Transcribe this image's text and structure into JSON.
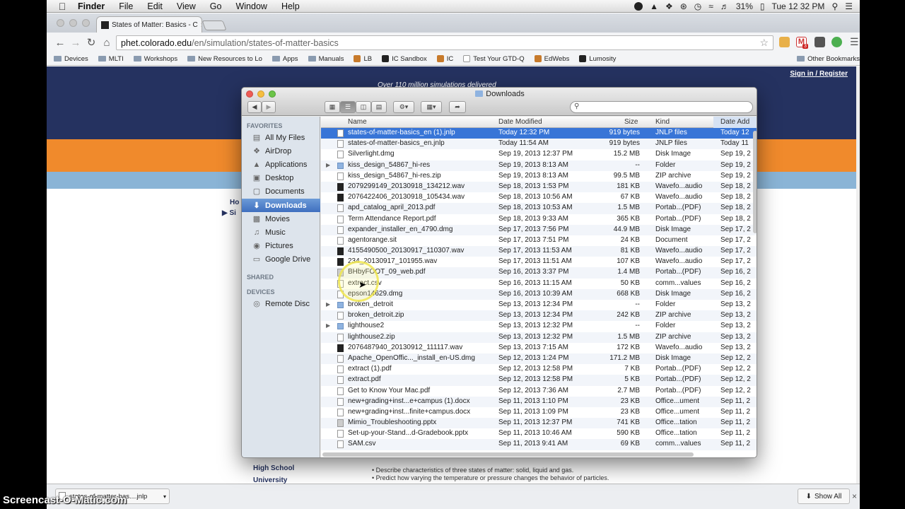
{
  "menubar": {
    "app": "Finder",
    "items": [
      "File",
      "Edit",
      "View",
      "Go",
      "Window",
      "Help"
    ],
    "battery": "31%",
    "clock": "Tue 12 32 PM"
  },
  "browser": {
    "tab_title": "States of Matter: Basics - C",
    "url_host": "phet.colorado.edu",
    "url_path": "/en/simulation/states-of-matter-basics",
    "bookmarks": [
      {
        "label": "Devices",
        "icon": "folder-icon"
      },
      {
        "label": "MLTI",
        "icon": "folder-icon"
      },
      {
        "label": "Workshops",
        "icon": "folder-icon"
      },
      {
        "label": "New Resources to Lo",
        "icon": "folder-icon"
      },
      {
        "label": "Apps",
        "icon": "folder-icon"
      },
      {
        "label": "Manuals",
        "icon": "folder-icon"
      },
      {
        "label": "LB",
        "icon": "site-icon"
      },
      {
        "label": "IC Sandbox",
        "icon": "site-icon"
      },
      {
        "label": "IC",
        "icon": "site-icon"
      },
      {
        "label": "Test Your GTD-Q",
        "icon": "page-icon"
      },
      {
        "label": "EdWebs",
        "icon": "site-icon"
      },
      {
        "label": "Lumosity",
        "icon": "site-icon"
      }
    ],
    "other_bookmarks": "Other Bookmarks",
    "ext_badge": "3"
  },
  "page": {
    "signin": "Sign in / Register",
    "tagline": "Over 110 million simulations delivered",
    "left_text_1": "Ho",
    "left_text_2": "Si",
    "level_1": "High School",
    "level_2": "University",
    "goals": [
      "Describe characteristics of three states of matter: solid, liquid and gas.",
      "Predict how varying the temperature or pressure changes the behavior of particles."
    ]
  },
  "downloads_bar": {
    "item": "states-of-matter-bas....jnlp",
    "show_all": "Show All"
  },
  "watermark": "Screencast-O-Matic.com",
  "finder": {
    "title": "Downloads",
    "sidebar": {
      "favorites_header": "FAVORITES",
      "favorites": [
        {
          "label": "All My Files",
          "icon": "all-files-icon"
        },
        {
          "label": "AirDrop",
          "icon": "airdrop-icon"
        },
        {
          "label": "Applications",
          "icon": "applications-icon"
        },
        {
          "label": "Desktop",
          "icon": "desktop-icon"
        },
        {
          "label": "Documents",
          "icon": "documents-icon"
        },
        {
          "label": "Downloads",
          "icon": "downloads-icon",
          "selected": true
        },
        {
          "label": "Movies",
          "icon": "movies-icon"
        },
        {
          "label": "Music",
          "icon": "music-icon"
        },
        {
          "label": "Pictures",
          "icon": "pictures-icon"
        },
        {
          "label": "Google Drive",
          "icon": "folder-icon"
        }
      ],
      "shared_header": "SHARED",
      "devices_header": "DEVICES",
      "devices": [
        {
          "label": "Remote Disc",
          "icon": "disc-icon"
        }
      ]
    },
    "columns": {
      "name": "Name",
      "date_modified": "Date Modified",
      "size": "Size",
      "kind": "Kind",
      "date_added": "Date Add"
    },
    "files": [
      {
        "name": "states-of-matter-basics_en (1).jnlp",
        "date": "Today 12:32 PM",
        "size": "919 bytes",
        "kind": "JNLP files",
        "added": "Today 12",
        "type": "doc",
        "selected": true
      },
      {
        "name": "states-of-matter-basics_en.jnlp",
        "date": "Today 11:54 AM",
        "size": "919 bytes",
        "kind": "JNLP files",
        "added": "Today 11",
        "type": "doc"
      },
      {
        "name": "Silverlight.dmg",
        "date": "Sep 19, 2013 12:37 PM",
        "size": "15.2 MB",
        "kind": "Disk Image",
        "added": "Sep 19, 2",
        "type": "doc"
      },
      {
        "name": "kiss_design_54867_hi-res",
        "date": "Sep 19, 2013 8:13 AM",
        "size": "--",
        "kind": "Folder",
        "added": "Sep 19, 2",
        "type": "folder"
      },
      {
        "name": "kiss_design_54867_hi-res.zip",
        "date": "Sep 19, 2013 8:13 AM",
        "size": "99.5 MB",
        "kind": "ZIP archive",
        "added": "Sep 19, 2",
        "type": "doc"
      },
      {
        "name": "2079299149_20130918_134212.wav",
        "date": "Sep 18, 2013 1:53 PM",
        "size": "181 KB",
        "kind": "Wavefo...audio",
        "added": "Sep 18, 2",
        "type": "wav"
      },
      {
        "name": "2076422406_20130918_105434.wav",
        "date": "Sep 18, 2013 10:56 AM",
        "size": "67 KB",
        "kind": "Wavefo...audio",
        "added": "Sep 18, 2",
        "type": "wav"
      },
      {
        "name": "apd_catalog_april_2013.pdf",
        "date": "Sep 18, 2013 10:53 AM",
        "size": "1.5 MB",
        "kind": "Portab...(PDF)",
        "added": "Sep 18, 2",
        "type": "doc"
      },
      {
        "name": "Term Attendance Report.pdf",
        "date": "Sep 18, 2013 9:33 AM",
        "size": "365 KB",
        "kind": "Portab...(PDF)",
        "added": "Sep 18, 2",
        "type": "doc"
      },
      {
        "name": "expander_installer_en_4790.dmg",
        "date": "Sep 17, 2013 7:56 PM",
        "size": "44.9 MB",
        "kind": "Disk Image",
        "added": "Sep 17, 2",
        "type": "doc"
      },
      {
        "name": "agentorange.sit",
        "date": "Sep 17, 2013 7:51 PM",
        "size": "24 KB",
        "kind": "Document",
        "added": "Sep 17, 2",
        "type": "doc"
      },
      {
        "name": "4155490500_20130917_110307.wav",
        "date": "Sep 17, 2013 11:53 AM",
        "size": "81 KB",
        "kind": "Wavefo...audio",
        "added": "Sep 17, 2",
        "type": "wav"
      },
      {
        "name": "234_20130917_101955.wav",
        "date": "Sep 17, 2013 11:51 AM",
        "size": "107 KB",
        "kind": "Wavefo...audio",
        "added": "Sep 17, 2",
        "type": "wav"
      },
      {
        "name": "BHbyFOOT_09_web.pdf",
        "date": "Sep 16, 2013 3:37 PM",
        "size": "1.4 MB",
        "kind": "Portab...(PDF)",
        "added": "Sep 16, 2",
        "type": "img"
      },
      {
        "name": "extract.csv",
        "date": "Sep 16, 2013 11:15 AM",
        "size": "50 KB",
        "kind": "comm...values",
        "added": "Sep 16, 2",
        "type": "doc"
      },
      {
        "name": "epson14629.dmg",
        "date": "Sep 16, 2013 10:39 AM",
        "size": "668 KB",
        "kind": "Disk Image",
        "added": "Sep 16, 2",
        "type": "doc"
      },
      {
        "name": "broken_detroit",
        "date": "Sep 13, 2013 12:34 PM",
        "size": "--",
        "kind": "Folder",
        "added": "Sep 13, 2",
        "type": "folder"
      },
      {
        "name": "broken_detroit.zip",
        "date": "Sep 13, 2013 12:34 PM",
        "size": "242 KB",
        "kind": "ZIP archive",
        "added": "Sep 13, 2",
        "type": "doc"
      },
      {
        "name": "lighthouse2",
        "date": "Sep 13, 2013 12:32 PM",
        "size": "--",
        "kind": "Folder",
        "added": "Sep 13, 2",
        "type": "folder"
      },
      {
        "name": "lighthouse2.zip",
        "date": "Sep 13, 2013 12:32 PM",
        "size": "1.5 MB",
        "kind": "ZIP archive",
        "added": "Sep 13, 2",
        "type": "doc"
      },
      {
        "name": "2076487940_20130912_111117.wav",
        "date": "Sep 13, 2013 7:15 AM",
        "size": "172 KB",
        "kind": "Wavefo...audio",
        "added": "Sep 13, 2",
        "type": "wav"
      },
      {
        "name": "Apache_OpenOffic..._install_en-US.dmg",
        "date": "Sep 12, 2013 1:24 PM",
        "size": "171.2 MB",
        "kind": "Disk Image",
        "added": "Sep 12, 2",
        "type": "doc"
      },
      {
        "name": "extract (1).pdf",
        "date": "Sep 12, 2013 12:58 PM",
        "size": "7 KB",
        "kind": "Portab...(PDF)",
        "added": "Sep 12, 2",
        "type": "doc"
      },
      {
        "name": "extract.pdf",
        "date": "Sep 12, 2013 12:58 PM",
        "size": "5 KB",
        "kind": "Portab...(PDF)",
        "added": "Sep 12, 2",
        "type": "doc"
      },
      {
        "name": "Get to Know Your Mac.pdf",
        "date": "Sep 12, 2013 7:36 AM",
        "size": "2.7 MB",
        "kind": "Portab...(PDF)",
        "added": "Sep 12, 2",
        "type": "doc"
      },
      {
        "name": "new+grading+inst...e+campus (1).docx",
        "date": "Sep 11, 2013 1:10 PM",
        "size": "23 KB",
        "kind": "Office...ument",
        "added": "Sep 11, 2",
        "type": "doc"
      },
      {
        "name": "new+grading+inst...finite+campus.docx",
        "date": "Sep 11, 2013 1:09 PM",
        "size": "23 KB",
        "kind": "Office...ument",
        "added": "Sep 11, 2",
        "type": "doc"
      },
      {
        "name": "Mimio_Troubleshooting.pptx",
        "date": "Sep 11, 2013 12:37 PM",
        "size": "741 KB",
        "kind": "Office...tation",
        "added": "Sep 11, 2",
        "type": "img"
      },
      {
        "name": "Set-up-your-Stand...d-Gradebook.pptx",
        "date": "Sep 11, 2013 10:46 AM",
        "size": "590 KB",
        "kind": "Office...tation",
        "added": "Sep 11, 2",
        "type": "doc"
      },
      {
        "name": "SAM.csv",
        "date": "Sep 11, 2013 9:41 AM",
        "size": "69 KB",
        "kind": "comm...values",
        "added": "Sep 11, 2",
        "type": "doc"
      }
    ]
  }
}
